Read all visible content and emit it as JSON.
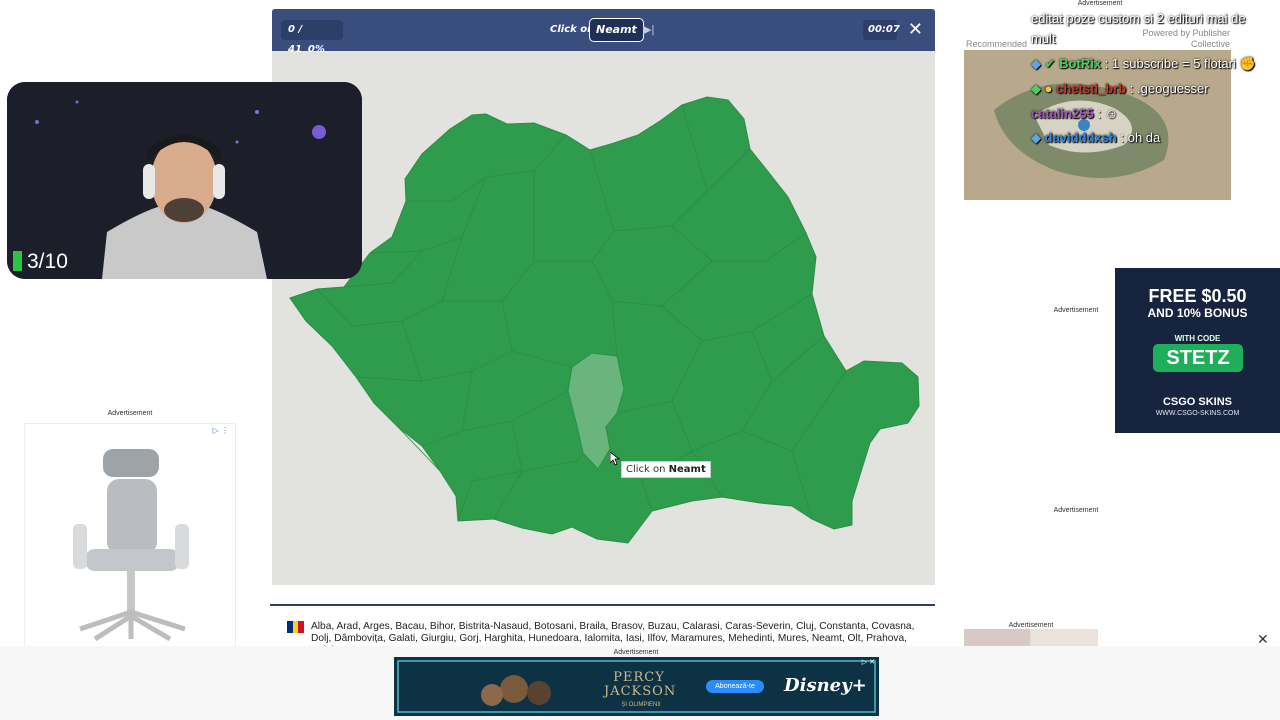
{
  "game": {
    "progress": "0 / 41",
    "percent": "0%",
    "prompt_prefix": "Click on",
    "target": "Neamt",
    "timer": "00:07",
    "tooltip_prefix": "Click on",
    "tooltip_target": "Neamt",
    "counties_list": "Alba, Arad, Arges, Bacau, Bihor, Bistrita-Nasaud, Botosani, Braila, Brasov, Buzau, Calarasi, Caras-Severin, Cluj, Constanta, Covasna, Dolj, Dâmbovița, Galati, Giurgiu, Gorj, Harghita, Hunedoara, Ialomita, Iasi, Ilfov, Maramures, Mehedinti, Mures, Neamt, Olt, Prahova, Salaj, Satu Mare,",
    "flag_colors": [
      "#002b7f",
      "#fcd116",
      "#ce1126"
    ],
    "map_color": "#2e9c4c",
    "highlight_color": "#6ab57d"
  },
  "webcam": {
    "counter": "3/10"
  },
  "ads": {
    "label": "Advertisement",
    "recommended": "Recommended",
    "powered_by": "Powered by Publisher Collective",
    "csgo_line1": "FREE $0.50",
    "csgo_line2": "AND 10% BONUS",
    "csgo_code_label": "WITH CODE",
    "csgo_code": "STETZ",
    "csgo_brand": "CSGO SKINS",
    "csgo_url": "WWW.CSGO-SKINS.COM",
    "banner_title": "PERCY JACKSON",
    "banner_subtitle": "ȘI OLIMPIENII",
    "banner_cta": "Abonează-te",
    "banner_brand": "Disney+"
  },
  "chat": {
    "top_text_1": "editat poze custom si 2 edituri mai de",
    "top_text_2": "mult",
    "messages": [
      {
        "user": "BotRix",
        "text": ": 1 subscribe = 5 flotari",
        "color": "#46d160"
      },
      {
        "user": "chetsti_brb",
        "text": ": .geoguesser",
        "color": "#c0392b"
      },
      {
        "user": "catalin255",
        "text": ":",
        "color": "#9b59b6"
      },
      {
        "user": "davidddxsh",
        "text": ": oh da",
        "color": "#2e86de"
      }
    ]
  }
}
